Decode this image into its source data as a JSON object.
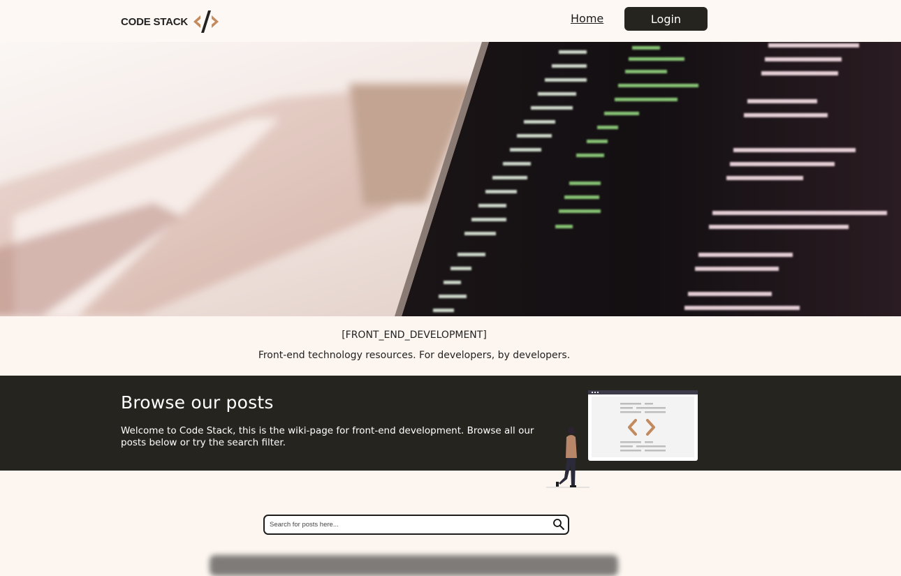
{
  "brand": {
    "name": "CODE STACK"
  },
  "nav": {
    "home_label": "Home",
    "login_label": "Login"
  },
  "tagline": {
    "title": "[FRONT_END_DEVELOPMENT]",
    "subtitle": "Front-end technology resources. For developers, by developers."
  },
  "browse": {
    "title": "Browse our posts",
    "description": "Welcome to Code Stack, this is the wiki-page for front-end development. Browse all our posts below or try the search filter."
  },
  "search": {
    "placeholder": "Search for posts here...",
    "value": ""
  },
  "icons": {
    "search": "search-icon",
    "logo": "code-slash-icon",
    "code": "code-brackets-icon"
  },
  "colors": {
    "dark": "#25241f",
    "accent": "#c38a5e",
    "background": "#fdf6f0"
  }
}
